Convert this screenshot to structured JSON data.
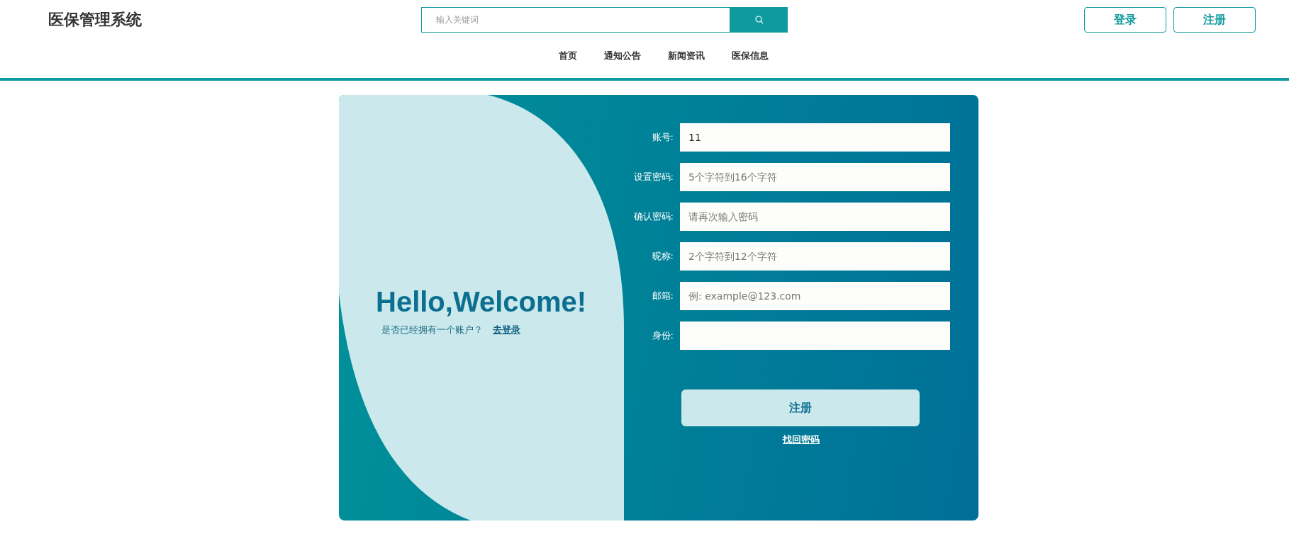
{
  "header": {
    "title": "医保管理系统",
    "search": {
      "placeholder": "输入关键词"
    },
    "auth_buttons": [
      "登录",
      "注册"
    ],
    "nav": [
      "首页",
      "通知公告",
      "新闻资讯",
      "医保信息"
    ]
  },
  "welcome": {
    "heading": "Hello,Welcome!",
    "prompt": "是否已经拥有一个账户？",
    "login_link": "去登录"
  },
  "form": {
    "fields": [
      {
        "label": "账号:",
        "value": "11"
      },
      {
        "label": "设置密码:",
        "placeholder": "5个字符到16个字符"
      },
      {
        "label": "确认密码:",
        "placeholder": "请再次输入密码"
      },
      {
        "label": "昵称:",
        "placeholder": "2个字符到12个字符"
      },
      {
        "label": "邮箱:",
        "placeholder": "例: example@123.com"
      },
      {
        "label": "身份:"
      }
    ],
    "submit": "注册",
    "recover_link": "找回密码"
  }
}
